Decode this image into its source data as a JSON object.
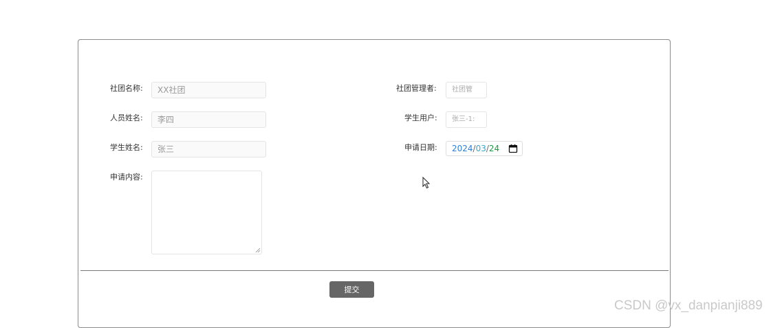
{
  "form": {
    "club_name": {
      "label": "社团名称:",
      "placeholder": "XX社团"
    },
    "member_name": {
      "label": "人员姓名:",
      "placeholder": "李四"
    },
    "student_name": {
      "label": "学生姓名:",
      "placeholder": "张三"
    },
    "content": {
      "label": "申请内容:"
    },
    "club_manager": {
      "label": "社团管理者:",
      "placeholder": "社团管"
    },
    "student_user": {
      "label": "学生用户:",
      "placeholder": "张三-1:"
    },
    "apply_date": {
      "label": "申请日期:",
      "year": "2024",
      "month": "03",
      "day": "24",
      "sep": "/"
    },
    "submit_label": "提交"
  },
  "watermark": "CSDN @vx_danpianji889",
  "icons": [
    "calendar-icon",
    "resize-handle-icon",
    "mouse-cursor-icon"
  ],
  "colors": {
    "date_year": "#2b7fd6",
    "date_month": "#3aa5c8",
    "date_day": "#1a9c3e",
    "button_bg": "#666666"
  }
}
